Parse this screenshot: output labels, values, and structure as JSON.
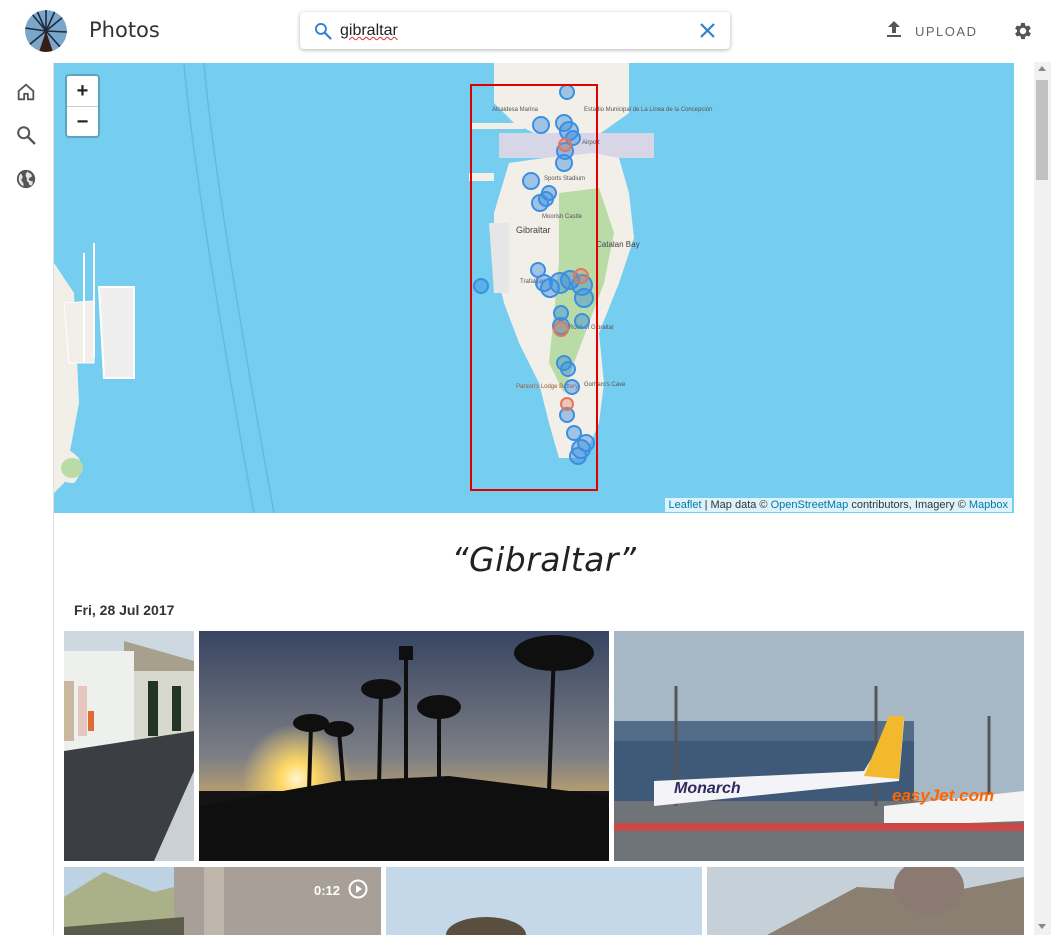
{
  "app": {
    "title": "Photos"
  },
  "search": {
    "query": "gibraltar"
  },
  "toolbar": {
    "upload_label": "UPLOAD"
  },
  "sidebar": {
    "items": [
      "home-icon",
      "search-icon",
      "globe-icon"
    ]
  },
  "map": {
    "zoom_in": "+",
    "zoom_out": "−",
    "labels": {
      "gibraltar": "Gibraltar",
      "catalan_bay": "Catalan Bay",
      "moorish_castle": "Moorish Castle",
      "parsons_lodge": "Parson's Lodge Battery",
      "airport": "Airport",
      "stadium": "Sports Stadium",
      "gorhams_cave": "Gorham's Cave",
      "rock": "Rock of Gibraltar",
      "alcaidesa": "Alcaidesa Marina",
      "estadio": "Estadio Municipal de La Línea de la Concepción",
      "trafalgar": "Trafalgar"
    },
    "attribution": {
      "leaflet": "Leaflet",
      "separator": " | Map data © ",
      "osm": "OpenStreetMap",
      "middle": " contributors, Imagery © ",
      "mapbox": "Mapbox"
    },
    "colors": {
      "water": "#75cdf0",
      "land": "#f2efe9",
      "park": "#b9dba6",
      "marker": "#3b8fe0",
      "marker_alt": "#e0785a",
      "bbox": "#e00000"
    }
  },
  "results": {
    "title": "“Gibraltar”",
    "groups": [
      {
        "date": "Fri, 28 Jul 2017",
        "items": [
          {
            "name": "photo-border-crossing"
          },
          {
            "name": "photo-sunset-palms"
          },
          {
            "name": "photo-airport-planes"
          },
          {
            "name": "video-rock-view",
            "duration": "0:12"
          },
          {
            "name": "photo-monkey-sky"
          },
          {
            "name": "photo-monkey-closeup"
          }
        ]
      }
    ]
  }
}
